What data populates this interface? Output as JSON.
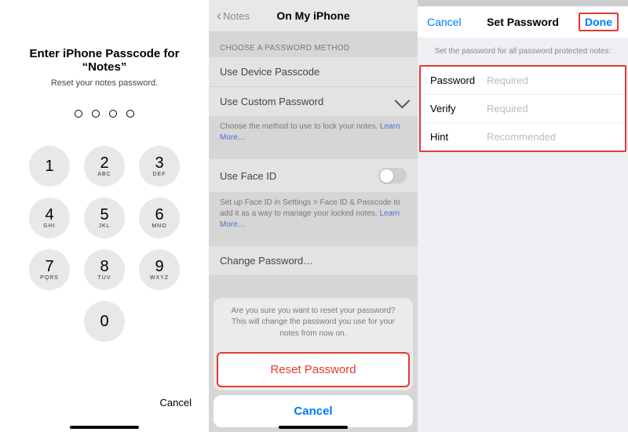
{
  "panel1": {
    "title": "Enter iPhone Passcode for “Notes”",
    "subtitle": "Reset your notes password.",
    "keys": [
      {
        "num": "1",
        "let": ""
      },
      {
        "num": "2",
        "let": "ABC"
      },
      {
        "num": "3",
        "let": "DEF"
      },
      {
        "num": "4",
        "let": "GHI"
      },
      {
        "num": "5",
        "let": "JKL"
      },
      {
        "num": "6",
        "let": "MNO"
      },
      {
        "num": "7",
        "let": "PQRS"
      },
      {
        "num": "8",
        "let": "TUV"
      },
      {
        "num": "9",
        "let": "WXYZ"
      },
      {
        "num": "0",
        "let": ""
      }
    ],
    "cancel": "Cancel"
  },
  "panel2": {
    "back": "Notes",
    "title": "On My iPhone",
    "section_header": "CHOOSE A PASSWORD METHOD",
    "opt_device": "Use Device Passcode",
    "opt_custom": "Use Custom Password",
    "method_footer_a": "Choose the method to use to lock your notes. ",
    "method_footer_link": "Learn More…",
    "faceid_label": "Use Face ID",
    "faceid_footer_a": "Set up Face ID in Settings > Face ID & Passcode to add it as a way to manage your locked notes. ",
    "faceid_footer_link": "Learn More…",
    "change_pw": "Change Password…",
    "sheet_msg_line1": "Are you sure you want to reset your password?",
    "sheet_msg_line2": "This will change the password you use for your notes from now on.",
    "sheet_reset": "Reset Password",
    "sheet_cancel": "Cancel"
  },
  "panel3": {
    "cancel": "Cancel",
    "title": "Set Password",
    "done": "Done",
    "subtitle": "Set the password for all password protected notes:",
    "rows": [
      {
        "label": "Password",
        "placeholder": "Required"
      },
      {
        "label": "Verify",
        "placeholder": "Required"
      },
      {
        "label": "Hint",
        "placeholder": "Recommended"
      }
    ]
  }
}
